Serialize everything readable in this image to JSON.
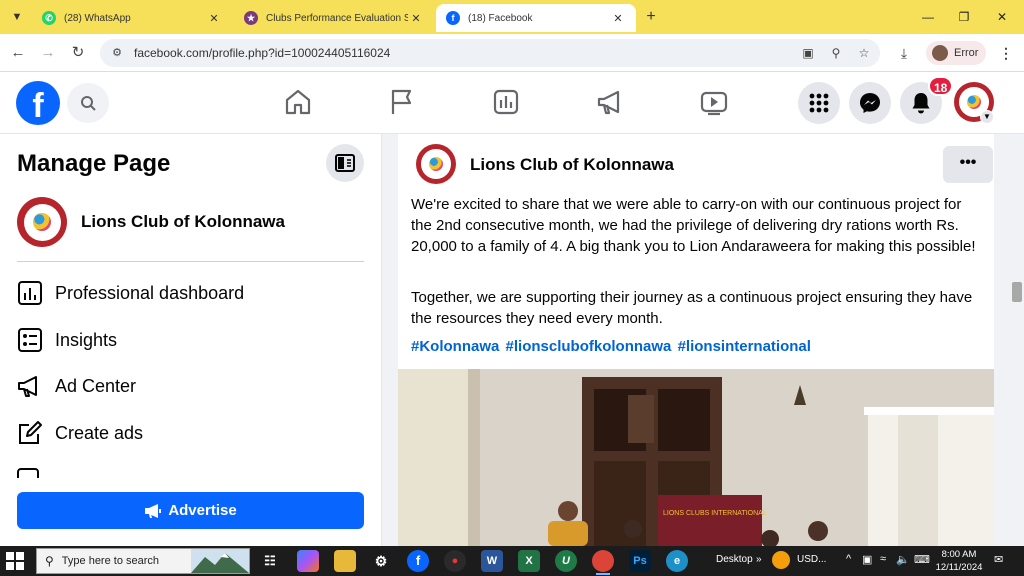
{
  "browser": {
    "tabs": [
      {
        "title": "(28) WhatsApp",
        "favicon": "whatsapp-icon",
        "active": false
      },
      {
        "title": "Clubs Performance Evaluation Syst",
        "favicon": "lions-emblem-icon",
        "active": false
      },
      {
        "title": "(18) Facebook",
        "favicon": "facebook-icon",
        "active": true
      }
    ],
    "url": "facebook.com/profile.php?id=100024405116024",
    "profile_label": "Error"
  },
  "fb_header": {
    "logo_letter": "f",
    "notification_count": "18",
    "nav_icons": [
      "home-icon",
      "flag-icon",
      "dashboard-icon",
      "megaphone-icon",
      "video-icon"
    ],
    "right_icons": [
      "menu-grid-icon",
      "messenger-icon",
      "bell-icon"
    ]
  },
  "left_panel": {
    "title": "Manage Page",
    "page_name": "Lions Club of Kolonnawa",
    "items": [
      {
        "label": "Professional dashboard",
        "icon": "dashboard-icon"
      },
      {
        "label": "Insights",
        "icon": "insights-icon"
      },
      {
        "label": "Ad Center",
        "icon": "megaphone-icon"
      },
      {
        "label": "Create ads",
        "icon": "pencil-icon"
      }
    ],
    "advertise_label": "Advertise"
  },
  "post": {
    "page_name": "Lions Club of Kolonnawa",
    "paragraph1": "We're excited to share that we were able to carry-on with our continuous project for the 2nd consecutive month, we had the privilege of delivering dry rations worth Rs. 20,000 to a family of 4. A big thank you to Lion Andaraweera for making this possible!",
    "paragraph2": "Together, we are supporting their journey as a continuous project ensuring they have the resources they need every month.",
    "hashtags": [
      "#Kolonnawa",
      "#lionsclubofkolonnawa",
      "#lionsinternational"
    ],
    "banner_text": "LIONS CLUBS INTERNATIONAL"
  },
  "taskbar": {
    "search_placeholder": "Type here to search",
    "desktop_label": "Desktop",
    "currency_label": "USD...",
    "time": "8:00 AM",
    "date": "12/11/2024"
  },
  "colors": {
    "fb_blue": "#0866ff",
    "chrome_tab_bar": "#f6e05a",
    "hashtag": "#0064d1",
    "notification_red": "#e41e3f"
  }
}
